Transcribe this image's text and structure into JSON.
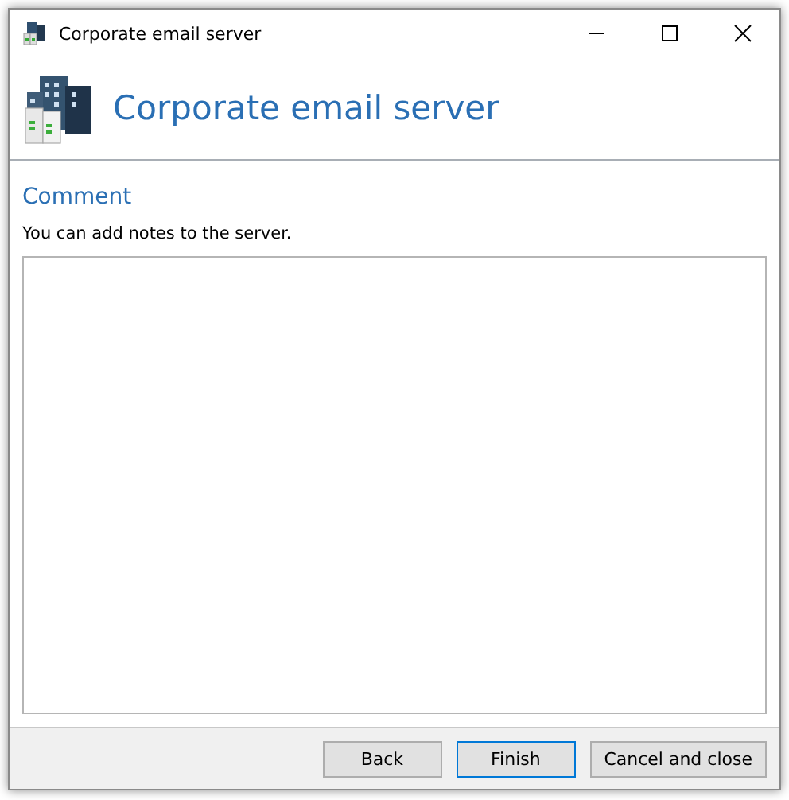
{
  "window": {
    "title": "Corporate email server"
  },
  "header": {
    "title": "Corporate email server"
  },
  "section": {
    "title": "Comment",
    "description": "You can add notes to the server."
  },
  "buttons": [
    {
      "label": "Back",
      "default": false
    },
    {
      "label": "Finish",
      "default": true
    },
    {
      "label": "Cancel and close",
      "default": false
    }
  ]
}
